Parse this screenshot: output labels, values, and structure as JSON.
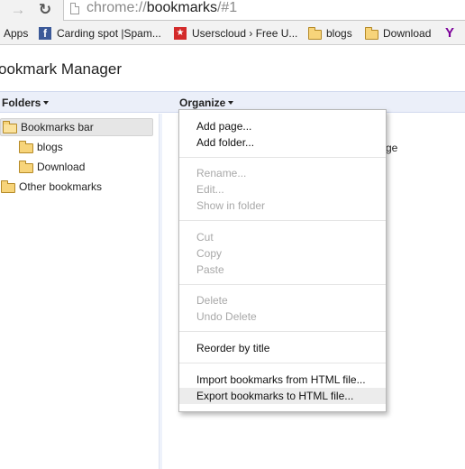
{
  "omnibox": {
    "url_scheme": "chrome://",
    "url_host": "bookmarks",
    "url_path": "/#1"
  },
  "bookmarks_bar": {
    "items": [
      {
        "label": "Apps",
        "icon": "apps-icon"
      },
      {
        "label": "Carding spot |Spam...",
        "icon": "facebook-icon"
      },
      {
        "label": "Userscloud › Free U...",
        "icon": "userscloud-icon"
      },
      {
        "label": "blogs",
        "icon": "folder-icon"
      },
      {
        "label": "Download",
        "icon": "folder-icon"
      },
      {
        "label": "",
        "icon": "yahoo-icon"
      }
    ]
  },
  "page": {
    "title": "ookmark Manager"
  },
  "toolbar": {
    "folders_label": "Folders",
    "organize_label": "Organize"
  },
  "tree": {
    "items": [
      {
        "label": "Bookmarks bar",
        "icon": "open-folder-icon",
        "selected": true
      },
      {
        "label": "blogs",
        "icon": "folder-icon"
      },
      {
        "label": "Download",
        "icon": "folder-icon"
      },
      {
        "label": "Other bookmarks",
        "icon": "folder-icon"
      }
    ]
  },
  "content": {
    "partial_text": "ge"
  },
  "organize_menu": {
    "items": [
      {
        "label": "Add page...",
        "enabled": true
      },
      {
        "label": "Add folder...",
        "enabled": true
      },
      {
        "label": "Rename...",
        "enabled": false
      },
      {
        "label": "Edit...",
        "enabled": false
      },
      {
        "label": "Show in folder",
        "enabled": false
      },
      {
        "label": "Cut",
        "enabled": false
      },
      {
        "label": "Copy",
        "enabled": false
      },
      {
        "label": "Paste",
        "enabled": false
      },
      {
        "label": "Delete",
        "enabled": false
      },
      {
        "label": "Undo Delete",
        "enabled": false
      },
      {
        "label": "Reorder by title",
        "enabled": true
      },
      {
        "label": "Import bookmarks from HTML file...",
        "enabled": true
      },
      {
        "label": "Export bookmarks to HTML file...",
        "enabled": true,
        "highlighted": true
      }
    ]
  },
  "colors": {
    "toolbar_bg": "#ebeff9",
    "folder_yellow": "#f7d47a",
    "disabled_text": "#a8a8a8",
    "facebook_blue": "#3b5998",
    "userscloud_red": "#d32a2a",
    "yahoo_purple": "#7b0099"
  }
}
